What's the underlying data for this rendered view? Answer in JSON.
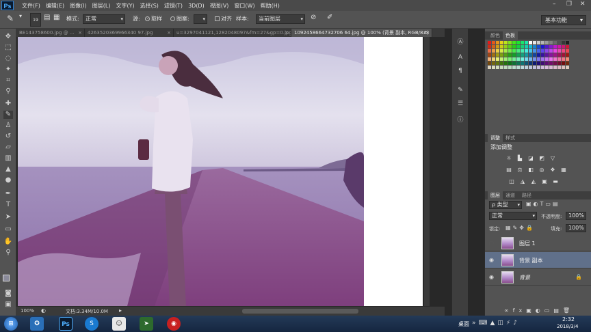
{
  "app": {
    "logo": "Ps"
  },
  "menu": [
    "文件(F)",
    "编辑(E)",
    "图像(I)",
    "图层(L)",
    "文字(Y)",
    "选择(S)",
    "滤镜(T)",
    "3D(D)",
    "视图(V)",
    "窗口(W)",
    "帮助(H)"
  ],
  "window_controls": {
    "minimize": "–",
    "restore": "❐",
    "close": "✕"
  },
  "options": {
    "brush_size": "19",
    "mode_label": "模式:",
    "mode_value": "正常",
    "source_label": "源:",
    "sampled_label": "取样",
    "pattern_label": "图案:",
    "aligned_label": "对齐",
    "sample_label": "样本:",
    "sample_value": "当前图层",
    "workspace": "基本功能"
  },
  "tabs": [
    {
      "label": "BE143758600.jpg @ ...",
      "close": "×"
    },
    {
      "label": "4263520369966340 97.jpg",
      "close": "×"
    },
    {
      "label": "u=3297041121,1282048097&fm=27&gp=0.jpg",
      "close": "×"
    },
    {
      "label": "1092458664732706 64.jpg @ 100% (背景 副本, RGB/8#)",
      "close": "×"
    }
  ],
  "status": {
    "zoom": "100%",
    "doc": "文档:3.34M/10.0M"
  },
  "panels": {
    "color_tabs": [
      "颜色",
      "色板"
    ],
    "adjust_tabs": [
      "调整",
      "样式"
    ],
    "adjust_title": "添加调整",
    "layers_tabs": [
      "图层",
      "通道",
      "路径"
    ],
    "kind_label": "类型",
    "blend_mode": "正常",
    "opacity_label": "不透明度:",
    "opacity_value": "100%",
    "lock_label": "锁定:",
    "fill_label": "填充:",
    "fill_value": "100%",
    "layers": [
      {
        "name": "图层 1",
        "visible": false,
        "selected": false,
        "locked": false
      },
      {
        "name": "背景 副本",
        "visible": true,
        "selected": true,
        "locked": false
      },
      {
        "name": "背景",
        "visible": true,
        "selected": false,
        "locked": true
      }
    ]
  },
  "taskbar": {
    "desktop_label": "桌面",
    "time": "2:32",
    "date": "2018/3/4"
  },
  "colors": {
    "accent": "#2f7fd0",
    "selected_layer": "#60708a"
  }
}
